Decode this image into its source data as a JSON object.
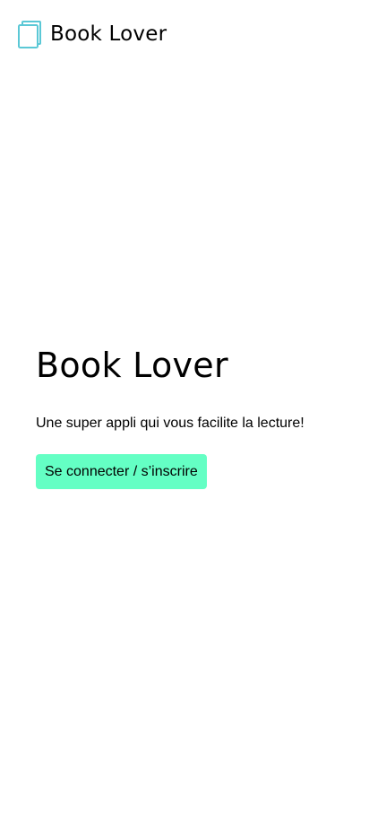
{
  "header": {
    "logo_icon": "book-icon",
    "brand_name": "Book Lover"
  },
  "hero": {
    "title": "Book Lover",
    "subtitle": "Une super appli qui vous facilite la lecture!",
    "cta_label": "Se connecter / s’inscrire"
  },
  "colors": {
    "accent": "#64ffc4",
    "logo": "#5bc8d6",
    "text": "#000000",
    "background": "#ffffff"
  }
}
